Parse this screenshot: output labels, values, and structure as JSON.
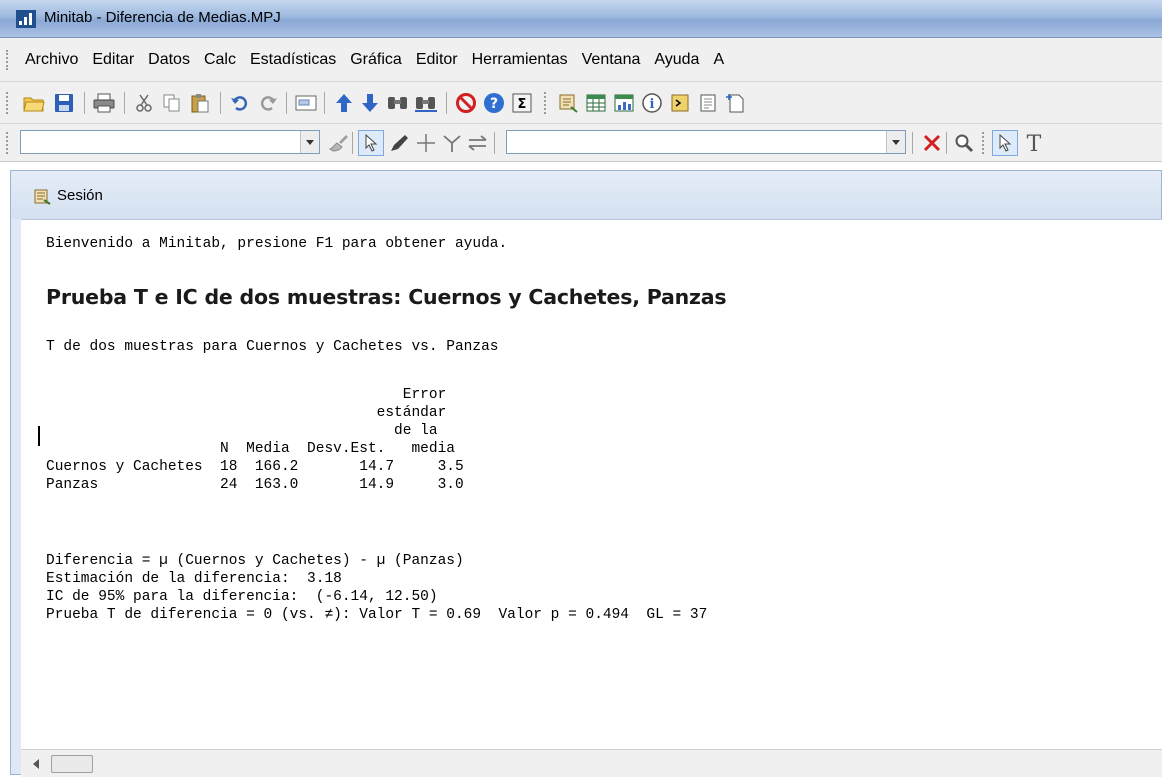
{
  "window": {
    "title": "Minitab - Diferencia de Medias.MPJ"
  },
  "menu": {
    "items": [
      "Archivo",
      "Editar",
      "Datos",
      "Calc",
      "Estadísticas",
      "Gráfica",
      "Editor",
      "Herramientas",
      "Ventana",
      "Ayuda",
      "A"
    ]
  },
  "session": {
    "title": "Sesión",
    "welcome": "Bienvenido a Minitab, presione F1 para obtener ayuda.",
    "heading": "Prueba T e IC de dos muestras: Cuernos y Cachetes, Panzas",
    "subtitle": "T de dos muestras para Cuernos y Cachetes vs. Panzas",
    "table": {
      "header_line1": "                                         Error",
      "header_line2": "                                      estándar",
      "header_line3": "                                        de la",
      "header_line4": "                    N  Media  Desv.Est.   media",
      "row1": "Cuernos y Cachetes  18  166.2       14.7     3.5",
      "row2": "Panzas              24  163.0       14.9     3.0"
    },
    "results": {
      "line1": "Diferencia = µ (Cuernos y Cachetes) - µ (Panzas)",
      "line2": "Estimación de la diferencia:  3.18",
      "line3": "IC de 95% para la diferencia:  (-6.14, 12.50)",
      "line4": "Prueba T de diferencia = 0 (vs. ≠): Valor T = 0.69  Valor p = 0.494  GL = 37"
    }
  },
  "colors": {
    "titlebar": "#9db9df",
    "toolbar_bg": "#f0f0f0",
    "session_frame": "#dfe8f5"
  }
}
